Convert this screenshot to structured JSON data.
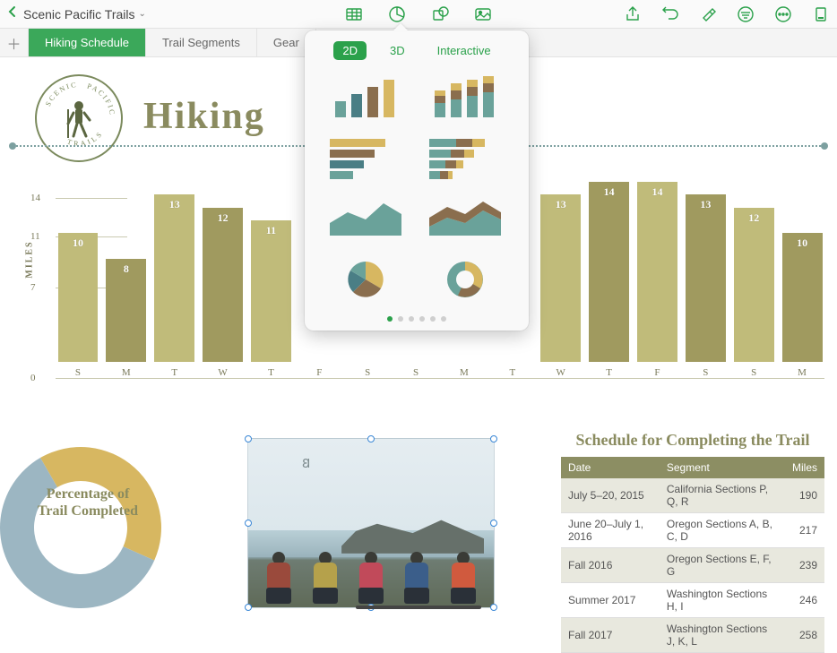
{
  "doc": {
    "name": "Scenic Pacific Trails"
  },
  "tabs": [
    {
      "label": "Hiking Schedule",
      "active": true
    },
    {
      "label": "Trail Segments",
      "active": false
    },
    {
      "label": "Gear",
      "active": false
    }
  ],
  "title": "Hiking",
  "logo": {
    "top": "SCENIC",
    "mid": "PACIFIC",
    "bottom": "TRAILS"
  },
  "chart_data": {
    "type": "bar",
    "title": "",
    "ylabel": "MILES",
    "yticks": [
      0,
      7,
      11,
      14
    ],
    "ylim": [
      0,
      16
    ],
    "categories": [
      "S",
      "M",
      "T",
      "W",
      "T",
      "F",
      "S",
      "S",
      "M",
      "T",
      "W",
      "T",
      "F",
      "S",
      "S",
      "M"
    ],
    "values": [
      10,
      8,
      13,
      12,
      11,
      null,
      null,
      null,
      null,
      null,
      13,
      14,
      14,
      13,
      12,
      10
    ]
  },
  "donut": {
    "label": "Percentage of Trail Completed",
    "segments": [
      {
        "color": "#d7b761",
        "pct": 40
      },
      {
        "color": "#9cb6c2",
        "pct": 60
      }
    ]
  },
  "table": {
    "title": "Schedule for Completing the Trail",
    "headers": [
      "Date",
      "Segment",
      "Miles"
    ],
    "rows": [
      [
        "July 5–20, 2015",
        "California Sections P, Q, R",
        "190"
      ],
      [
        "June 20–July 1, 2016",
        "Oregon Sections A, B, C, D",
        "217"
      ],
      [
        "Fall 2016",
        "Oregon Sections E, F, G",
        "239"
      ],
      [
        "Summer 2017",
        "Washington Sections H, I",
        "246"
      ],
      [
        "Fall 2017",
        "Washington Sections J, K, L",
        "258"
      ]
    ]
  },
  "popup": {
    "tabs": [
      "2D",
      "3D",
      "Interactive"
    ],
    "active_tab": "2D",
    "page_dots": 6,
    "active_dot": 0
  },
  "figure_colors": [
    "#9a4a3c",
    "#b5a14b",
    "#c14a5a",
    "#3b5e8a",
    "#d05a3e"
  ]
}
